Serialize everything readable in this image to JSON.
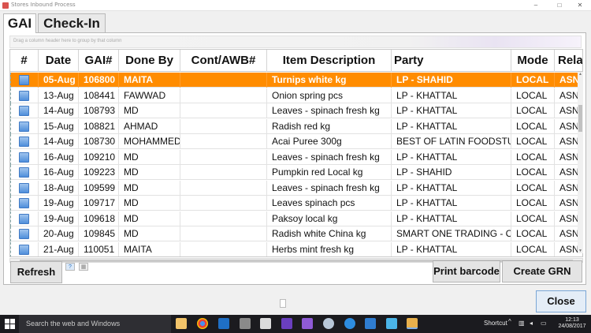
{
  "window": {
    "title": "Stores Inbound Process",
    "controls": {
      "minimize": "–",
      "maximize": "□",
      "close": "✕"
    }
  },
  "tabs": [
    {
      "label": "GAI",
      "active": true
    },
    {
      "label": "Check-In",
      "active": false
    }
  ],
  "group_bar": {
    "hint": "Drag a column header here to group by that column"
  },
  "grid": {
    "columns": [
      "#",
      "Date",
      "GAI#",
      "Done By",
      "Cont/AWB#",
      "Item Description",
      "Party",
      "Mode",
      "Rela"
    ],
    "selected_index": 0,
    "rows": [
      {
        "date": "05-Aug",
        "gai": "106800",
        "done_by": "MAITA",
        "cont": "",
        "item": "Turnips white kg",
        "party": "LP - SHAHID",
        "mode": "LOCAL",
        "rela": "ASN"
      },
      {
        "date": "13-Aug",
        "gai": "108441",
        "done_by": "FAWWAD",
        "cont": "",
        "item": "Onion spring pcs",
        "party": "LP - KHATTAL",
        "mode": "LOCAL",
        "rela": "ASN-"
      },
      {
        "date": "14-Aug",
        "gai": "108793",
        "done_by": "MD",
        "cont": "",
        "item": "Leaves - spinach fresh kg",
        "party": "LP - KHATTAL",
        "mode": "LOCAL",
        "rela": "ASN-"
      },
      {
        "date": "15-Aug",
        "gai": "108821",
        "done_by": "AHMAD",
        "cont": "",
        "item": "Radish red kg",
        "party": "LP - KHATTAL",
        "mode": "LOCAL",
        "rela": "ASN-"
      },
      {
        "date": "14-Aug",
        "gai": "108730",
        "done_by": "MOHAMMED",
        "cont": "",
        "item": "Acai Puree 300g",
        "party": "BEST OF LATIN FOODSTU...",
        "mode": "LOCAL",
        "rela": "ASN-"
      },
      {
        "date": "16-Aug",
        "gai": "109210",
        "done_by": "MD",
        "cont": "",
        "item": "Leaves - spinach fresh kg",
        "party": "LP - KHATTAL",
        "mode": "LOCAL",
        "rela": "ASN-"
      },
      {
        "date": "16-Aug",
        "gai": "109223",
        "done_by": "MD",
        "cont": "",
        "item": "Pumpkin red Local kg",
        "party": "LP - SHAHID",
        "mode": "LOCAL",
        "rela": "ASN-"
      },
      {
        "date": "18-Aug",
        "gai": "109599",
        "done_by": "MD",
        "cont": "",
        "item": "Leaves - spinach fresh kg",
        "party": "LP - KHATTAL",
        "mode": "LOCAL",
        "rela": "ASN-"
      },
      {
        "date": "19-Aug",
        "gai": "109717",
        "done_by": "MD",
        "cont": "",
        "item": "Leaves spinach pcs",
        "party": "LP - KHATTAL",
        "mode": "LOCAL",
        "rela": "ASN-"
      },
      {
        "date": "19-Aug",
        "gai": "109618",
        "done_by": "MD",
        "cont": "",
        "item": "Paksoy local kg",
        "party": "LP - KHATTAL",
        "mode": "LOCAL",
        "rela": "ASN-"
      },
      {
        "date": "20-Aug",
        "gai": "109845",
        "done_by": "MD",
        "cont": "",
        "item": "Radish white China kg",
        "party": "SMART ONE TRADING - C...",
        "mode": "LOCAL",
        "rela": "ASN-"
      },
      {
        "date": "21-Aug",
        "gai": "110051",
        "done_by": "MAITA",
        "cont": "",
        "item": "Herbs mint fresh kg",
        "party": "LP - KHATTAL",
        "mode": "LOCAL",
        "rela": "ASN-"
      }
    ]
  },
  "buttons": {
    "refresh": "Refresh",
    "print_barcode": "Print barcode",
    "create_grn": "Create GRN",
    "close": "Close"
  },
  "taskbar": {
    "search_placeholder": "Search the web and Windows",
    "shortcut_label": "Shortcut",
    "time": "12:13",
    "date": "24/08/2017"
  },
  "colors": {
    "selected_row": "#ff8c00",
    "checkbox": "#4f8fdb",
    "taskbar": "#1b1b1f"
  }
}
